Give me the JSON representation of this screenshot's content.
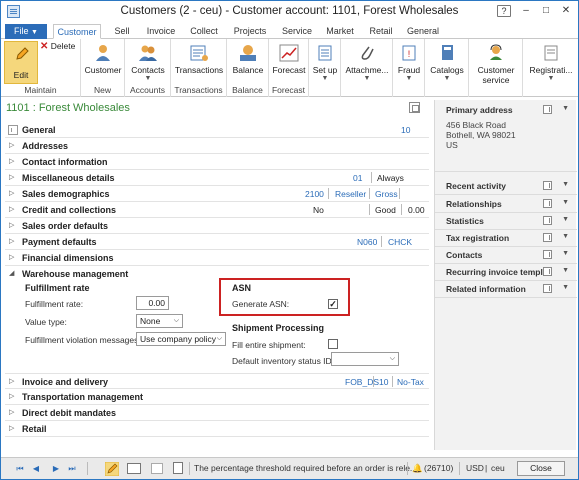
{
  "window": {
    "title": "Customers (2 - ceu) - Customer account: 1101, Forest Wholesales",
    "help": "?"
  },
  "ribbon_tabs": [
    "File",
    "Customer",
    "Sell",
    "Invoice",
    "Collect",
    "Projects",
    "Service",
    "Market",
    "Retail",
    "General"
  ],
  "ribbon": {
    "edit": "Edit",
    "delete": "Delete",
    "customer": "Customer",
    "contacts": "Contacts",
    "transactions": "Transactions",
    "balance": "Balance",
    "forecast": "Forecast",
    "setup": "Set up",
    "attachments": "Attachme...",
    "fraud": "Fraud",
    "catalogs": "Catalogs",
    "customer_service_1": "Customer",
    "customer_service_2": "service",
    "registration": "Registrati...",
    "groups": {
      "maintain": "Maintain",
      "new": "New",
      "accounts": "Accounts",
      "transactions": "Transactions",
      "balance": "Balance",
      "forecast": "Forecast"
    }
  },
  "form": {
    "header": "1101 : Forest Wholesales"
  },
  "fasttabs": {
    "general": {
      "label": "General",
      "summary": "10"
    },
    "addresses": {
      "label": "Addresses"
    },
    "contact": {
      "label": "Contact information"
    },
    "misc": {
      "label": "Miscellaneous details",
      "summary1": "01",
      "summary2": "Always"
    },
    "sales_demo": {
      "label": "Sales demographics",
      "s1": "2100",
      "s2": "Reseller",
      "s3": "Gross"
    },
    "credit": {
      "label": "Credit and collections",
      "s1": "No",
      "s2": "Good",
      "s3": "0.00"
    },
    "sales_order": {
      "label": "Sales order defaults"
    },
    "payment": {
      "label": "Payment defaults",
      "s1": "N060",
      "s2": "CHCK"
    },
    "financial": {
      "label": "Financial dimensions"
    },
    "warehouse": {
      "label": "Warehouse management"
    },
    "invoice": {
      "label": "Invoice and delivery",
      "s1": "FOB_DS",
      "s2": "10",
      "s3": "No-Tax"
    },
    "transport": {
      "label": "Transportation management"
    },
    "direct_debit": {
      "label": "Direct debit mandates"
    },
    "retail": {
      "label": "Retail"
    }
  },
  "warehouse": {
    "fulfillment_title": "Fulfillment rate",
    "fulfillment_rate_label": "Fulfillment rate:",
    "fulfillment_rate_value": "0.00",
    "value_type_label": "Value type:",
    "value_type_value": "None",
    "violation_label": "Fulfillment violation messages:",
    "violation_value": "Use company policy",
    "asn_title": "ASN",
    "generate_asn_label": "Generate ASN:",
    "generate_asn_checked": true,
    "shipment_title": "Shipment Processing",
    "fill_entire_label": "Fill entire shipment:",
    "fill_entire_checked": false,
    "default_status_label": "Default inventory status ID:",
    "default_status_value": ""
  },
  "factboxes": {
    "primary_address": "Primary address",
    "address_lines": [
      "456 Black Road",
      "Bothell, WA 98021",
      "US"
    ],
    "recent_activity": "Recent activity",
    "relationships": "Relationships",
    "statistics": "Statistics",
    "tax_registration": "Tax registration",
    "contacts": "Contacts",
    "recurring": "Recurring invoice templ...",
    "related": "Related information"
  },
  "statusbar": {
    "message": "The percentage threshold required before an order is rele...",
    "notifications": "(26710)",
    "currency": "USD",
    "company": "ceu",
    "close": "Close"
  },
  "colors": {
    "accent": "#2b6cb8",
    "header_green": "#3a8a3a",
    "highlight_red": "#cc2222",
    "edit_yellow": "#f5d77c"
  }
}
